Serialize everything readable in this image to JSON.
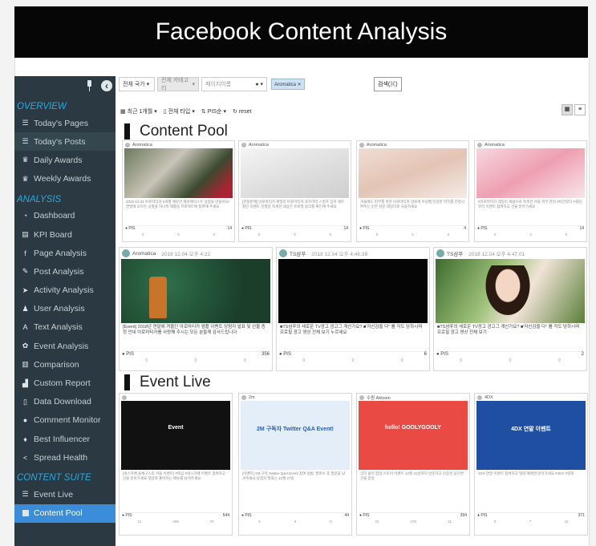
{
  "banner_title": "Facebook Content Analysis",
  "sidebar": {
    "sections": [
      {
        "title": "OVERVIEW",
        "items": [
          {
            "label": "Today's Pages",
            "icon": "list-icon"
          },
          {
            "label": "Today's Posts",
            "icon": "list-icon"
          },
          {
            "label": "Daily Awards",
            "icon": "trophy-icon"
          },
          {
            "label": "Weekly Awards",
            "icon": "trophy-icon"
          }
        ]
      },
      {
        "title": "ANALYSIS",
        "items": [
          {
            "label": "Dashboard",
            "icon": "dashboard-icon"
          },
          {
            "label": "KPI Board",
            "icon": "table-icon"
          },
          {
            "label": "Page Analysis",
            "icon": "facebook-icon"
          },
          {
            "label": "Post Analysis",
            "icon": "edit-icon"
          },
          {
            "label": "Activity Analysis",
            "icon": "cursor-icon"
          },
          {
            "label": "User Analysis",
            "icon": "user-icon"
          },
          {
            "label": "Text Analysis",
            "icon": "text-icon"
          },
          {
            "label": "Event Analysis",
            "icon": "gift-icon"
          },
          {
            "label": "Comparison",
            "icon": "columns-icon"
          },
          {
            "label": "Custom Report",
            "icon": "bar-chart-icon"
          },
          {
            "label": "Data Download",
            "icon": "file-icon"
          },
          {
            "label": "Comment Monitor",
            "icon": "comment-icon"
          },
          {
            "label": "Best Influencer",
            "icon": "microphone-icon"
          },
          {
            "label": "Spread Health",
            "icon": "share-icon"
          }
        ]
      },
      {
        "title": "CONTENT SUITE",
        "items": [
          {
            "label": "Event Live",
            "icon": "list-icon"
          },
          {
            "label": "Content Pool",
            "icon": "square-icon"
          }
        ]
      }
    ]
  },
  "toolbar": {
    "country": "전체 국가",
    "category": "전체 카테고리",
    "search_placeholder": "페이지이름",
    "tag": "Aromatica ✕",
    "search_button": "검색(⌘)"
  },
  "toolbar2": {
    "period": "최근 1개월",
    "type": "전체 타입",
    "sort": "PIS순",
    "reset": "reset"
  },
  "sections": {
    "pool": "Content Pool",
    "event": "Event Live"
  },
  "pool_small": [
    {
      "page": "Aromatica",
      "text": "2018 12.04 아로마티카 6개월 깨끗한 제로웨이스트 상점을 만들어요! 연말에 모아둔 공병을 하나씩 재활용 프로젝트에 참여해 주세요",
      "pis": "14",
      "stats": [
        "0",
        "0",
        "0"
      ]
    },
    {
      "page": "Aromatica",
      "text": "[한정판매] 아로마티카 패밀리 아로마티카 로즈마리 스칼프 샴푸 세트 할인 이벤트 진행중 자세한 내용은 프로필 링크를 확인해 주세요",
      "pis": "14",
      "stats": [
        "0",
        "0",
        "0"
      ]
    },
    {
      "page": "Aromatica",
      "text": "겨울에도 피부를 위한 아로마티카 알로에 수딩젤 민감한 피부를 진정시켜주는 순한 성분 데일리로 사용하세요",
      "pis": "4",
      "stats": [
        "0",
        "0",
        "0"
      ]
    },
    {
      "page": "Aromatica",
      "text": "#아로마티카 데일리 세럼으로 촉촉한 겨울 피부 관리 #비건뷰티 #클린뷰티 이벤트 참여하고 선물 받아가세요",
      "pis": "14",
      "stats": [
        "0",
        "0",
        "0"
      ]
    }
  ],
  "pool_large": [
    {
      "page": "Aromatica",
      "date": "2018 12.04 오후 4:22",
      "text": "[Event] 2018년 연말에 겨울딘 아로마티카 앰플 이벤트 당첨자 발표 및 선물 증정 안내 아로마티카를 사랑해 주시는 모든 분들께 감사드립니다",
      "pis": "356",
      "stats": [
        "0",
        "0",
        "0"
      ]
    },
    {
      "page": "TS샴푸",
      "date": "2018 12.04 오후 4:46:38",
      "text": "■TS샴푸의 새로운 TV광고 광고그 계신가요? ■'자신감을 다'' 를 각도 당하시며 프로필 광고 영상 전체 보기 누르세요",
      "pis": "6",
      "stats": [
        "0",
        "0",
        "0"
      ]
    },
    {
      "page": "TS샴푸",
      "date": "2018 12.04 오후 4:47:01",
      "text": "■TS샴푸의 새로운 TV광고 광고그 계신가요? ■'자신감을 다'' 를 각도 당하시며 프로필 광고 영상 전체 보기",
      "pis": "2",
      "stats": [
        "0",
        "0",
        "0"
      ]
    }
  ],
  "event_cards": [
    {
      "page": "",
      "text": "[네스카페 돌체구스토 겨울 이벤트] #맥심 #네스카페 이벤트 참여하고 선물 받아가세요 댓글로 좋아하는 메뉴를 남겨주세요",
      "pis": "544",
      "stats": [
        "31",
        "285",
        "76"
      ],
      "bg": "#111111",
      "label": "Event"
    },
    {
      "page": "2m",
      "text": "[이벤트] 2M 구독 Twitter Q&A Event 참여 방법: 팔로우 후 질문을 남겨주세요 당첨자 발표는 12월 27일",
      "pis": "44",
      "stats": [
        "9",
        "0",
        "0"
      ],
      "bg": "#e3eef9",
      "label": "2M 구독자 Twitter Q&A Event!"
    },
    {
      "page": "수원 Aktown",
      "text": "굿리 플리 팝업 스토어 이벤트 12월 31일까지 방문하고 인증샷 남기면 선물 증정",
      "pis": "394",
      "stats": [
        "21",
        "278",
        "11"
      ],
      "bg": "#e94b44",
      "label": "hello! GOOLYGOOLY"
    },
    {
      "page": "4DX",
      "text": "4DX 연말 이벤트 참여하고 영화 예매권 받아가세요 #4DX #영화",
      "pis": "371",
      "stats": [
        "0",
        "7",
        "11"
      ],
      "bg": "#1e4fa3",
      "label": "4DX 연말 이벤트"
    }
  ],
  "colors": {
    "sidebar": "#2b3a42",
    "accent": "#27a9e1",
    "active": "#3c8dd9"
  }
}
